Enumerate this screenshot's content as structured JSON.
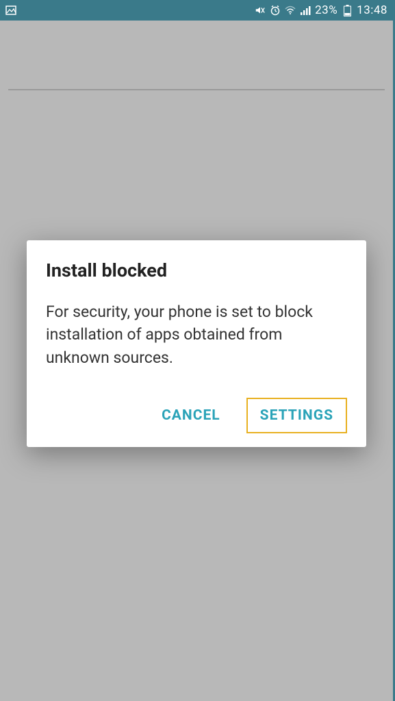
{
  "status_bar": {
    "battery_percent": "23%",
    "time": "13:48"
  },
  "dialog": {
    "title": "Install blocked",
    "message": "For security, your phone is set to block installation of apps obtained from unknown sources.",
    "cancel_label": "CANCEL",
    "settings_label": "SETTINGS"
  }
}
